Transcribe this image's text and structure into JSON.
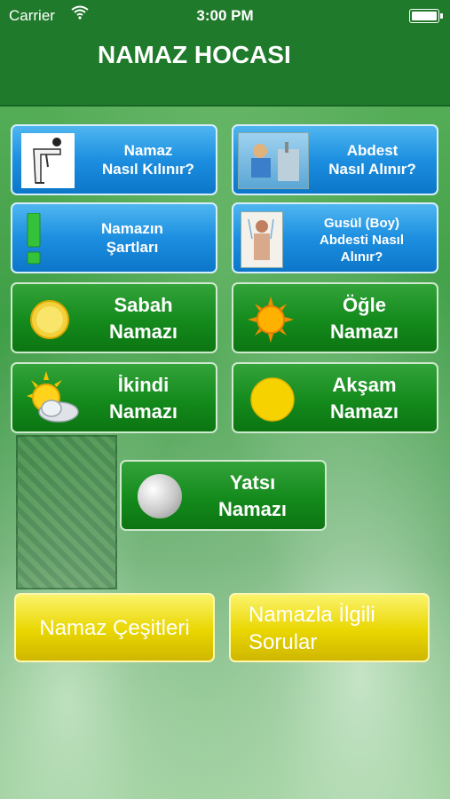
{
  "status": {
    "carrier": "Carrier",
    "wifi_icon": "wifi-icon",
    "time": "3:00 PM",
    "battery_icon": "battery-icon"
  },
  "nav": {
    "title": "NAMAZ HOCASI"
  },
  "buttons": {
    "namaz_nasil": {
      "line1": "Namaz",
      "line2": "Nasıl Kılınır?",
      "icon": "praying-man-icon"
    },
    "abdest": {
      "line1": "Abdest",
      "line2": "Nasıl Alınır?",
      "icon": "ablution-image-icon"
    },
    "sartlar": {
      "line1": "Namazın",
      "line2": "Şartları",
      "icon": "exclamation-icon"
    },
    "gusul": {
      "line1": "Gusül (Boy)",
      "line2": "Abdesti Nasıl",
      "line3": "Alınır?",
      "icon": "shower-image-icon"
    },
    "sabah": {
      "line1": "Sabah",
      "line2": "Namazı",
      "icon": "rising-sun-icon"
    },
    "ogle": {
      "line1": "Öğle",
      "line2": "Namazı",
      "icon": "bright-sun-icon"
    },
    "ikindi": {
      "line1": "İkindi",
      "line2": "Namazı",
      "icon": "sun-cloud-icon"
    },
    "aksam": {
      "line1": "Akşam",
      "line2": "Namazı",
      "icon": "setting-sun-icon"
    },
    "yatsi": {
      "line1": "Yatsı",
      "line2": "Namazı",
      "icon": "moon-icon"
    },
    "cesitler": {
      "line1": "Namaz Çeşitleri"
    },
    "sorular": {
      "line1": "Namazla İlgili",
      "line2": "Sorular"
    }
  },
  "colors": {
    "header": "#1f7a2b",
    "blue_button": "#1d8fe0",
    "green_button": "#148a1c",
    "yellow_button": "#e9d600"
  }
}
